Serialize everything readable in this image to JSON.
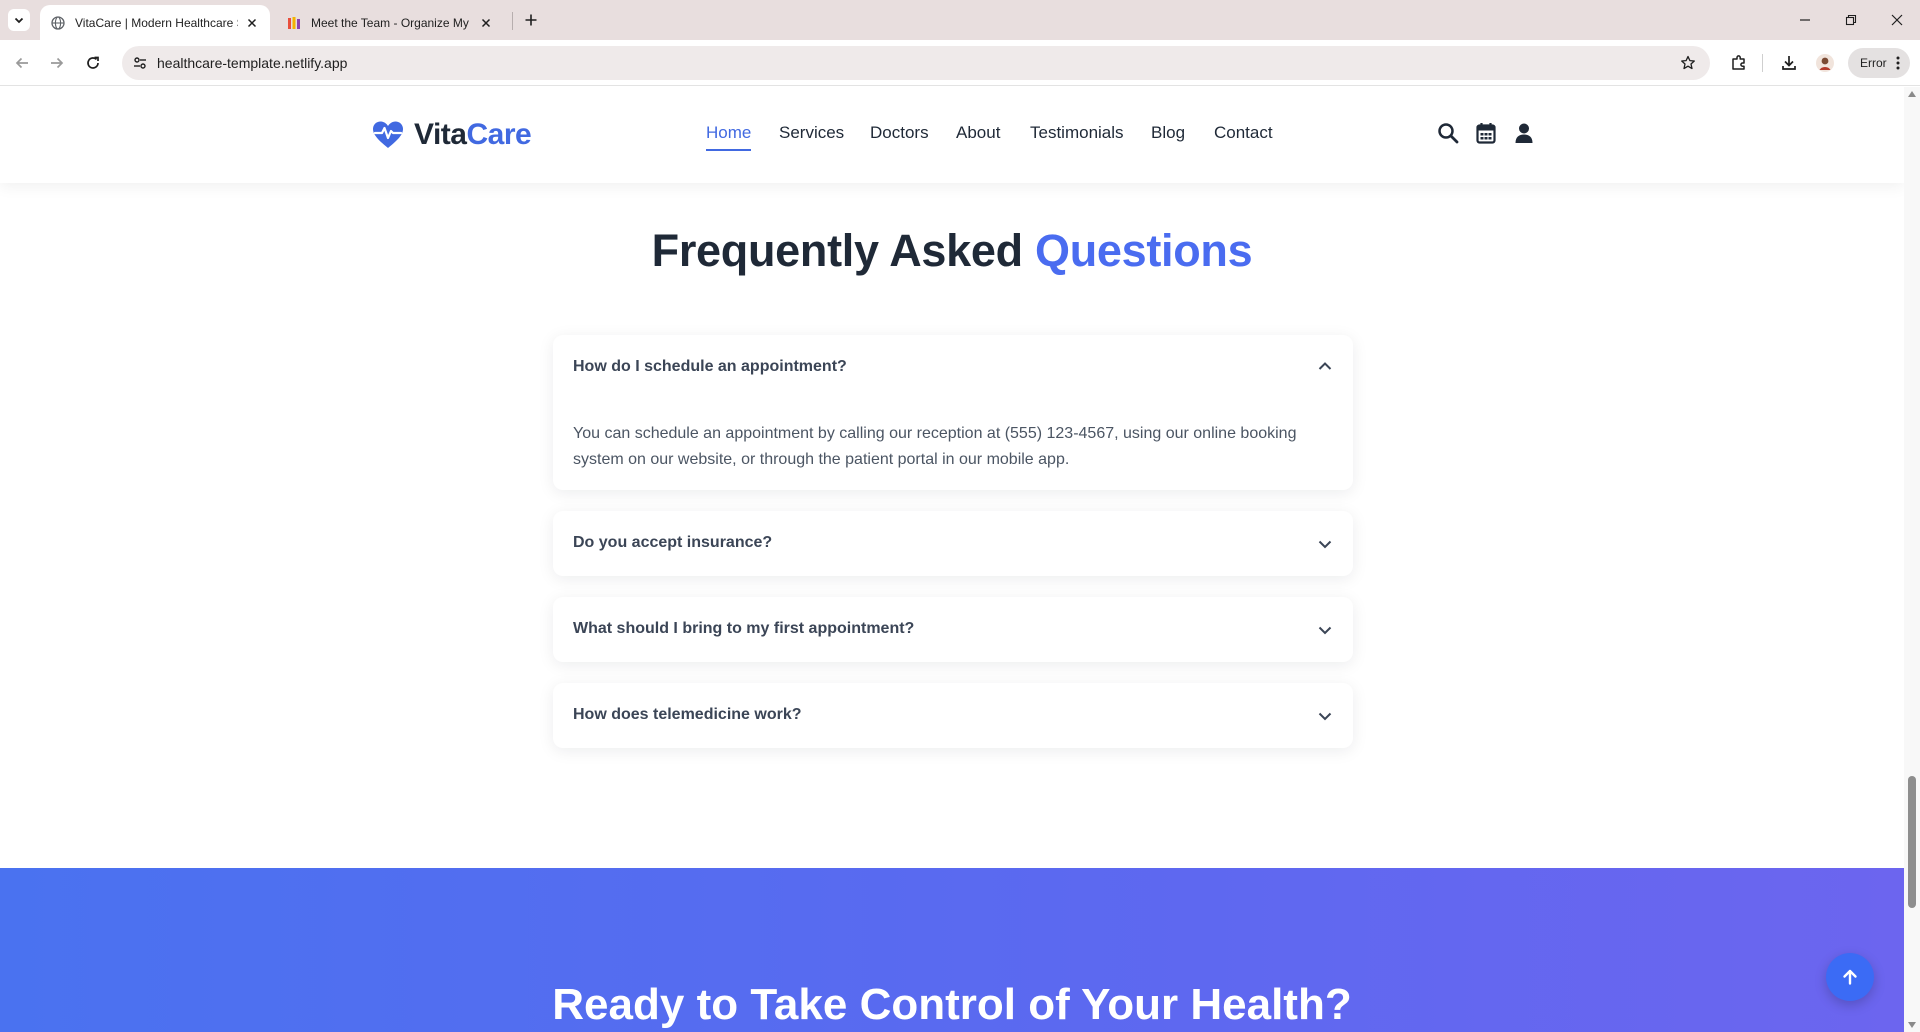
{
  "browser": {
    "tabs": [
      {
        "title": "VitaCare | Modern Healthcare S",
        "active": true
      },
      {
        "title": "Meet the Team - Organize My F",
        "active": false
      }
    ],
    "url": "healthcare-template.netlify.app",
    "profile_status": "Error"
  },
  "header": {
    "logo": {
      "part1": "Vita",
      "part2": "Care"
    },
    "nav": [
      "Home",
      "Services",
      "Doctors",
      "About",
      "Testimonials",
      "Blog",
      "Contact"
    ],
    "active_nav": "Home"
  },
  "faq": {
    "title_main": "Frequently Asked",
    "title_accent": "Questions",
    "items": [
      {
        "question": "How do I schedule an appointment?",
        "expanded": true,
        "answer": "You can schedule an appointment by calling our reception at (555) 123-4567, using our online booking system on our website, or through the patient portal in our mobile app."
      },
      {
        "question": "Do you accept insurance?",
        "expanded": false
      },
      {
        "question": "What should I bring to my first appointment?",
        "expanded": false
      },
      {
        "question": "How does telemedicine work?",
        "expanded": false
      }
    ]
  },
  "cta": {
    "title": "Ready to Take Control of Your Health?"
  },
  "colors": {
    "brand": "#4169e1",
    "heading": "#1f2937",
    "cta_start": "#4a72f0",
    "cta_end": "#6c65ef"
  },
  "icons": {
    "header": [
      "search-icon",
      "calendar-icon",
      "user-icon"
    ],
    "floating": "arrow-up-icon"
  }
}
